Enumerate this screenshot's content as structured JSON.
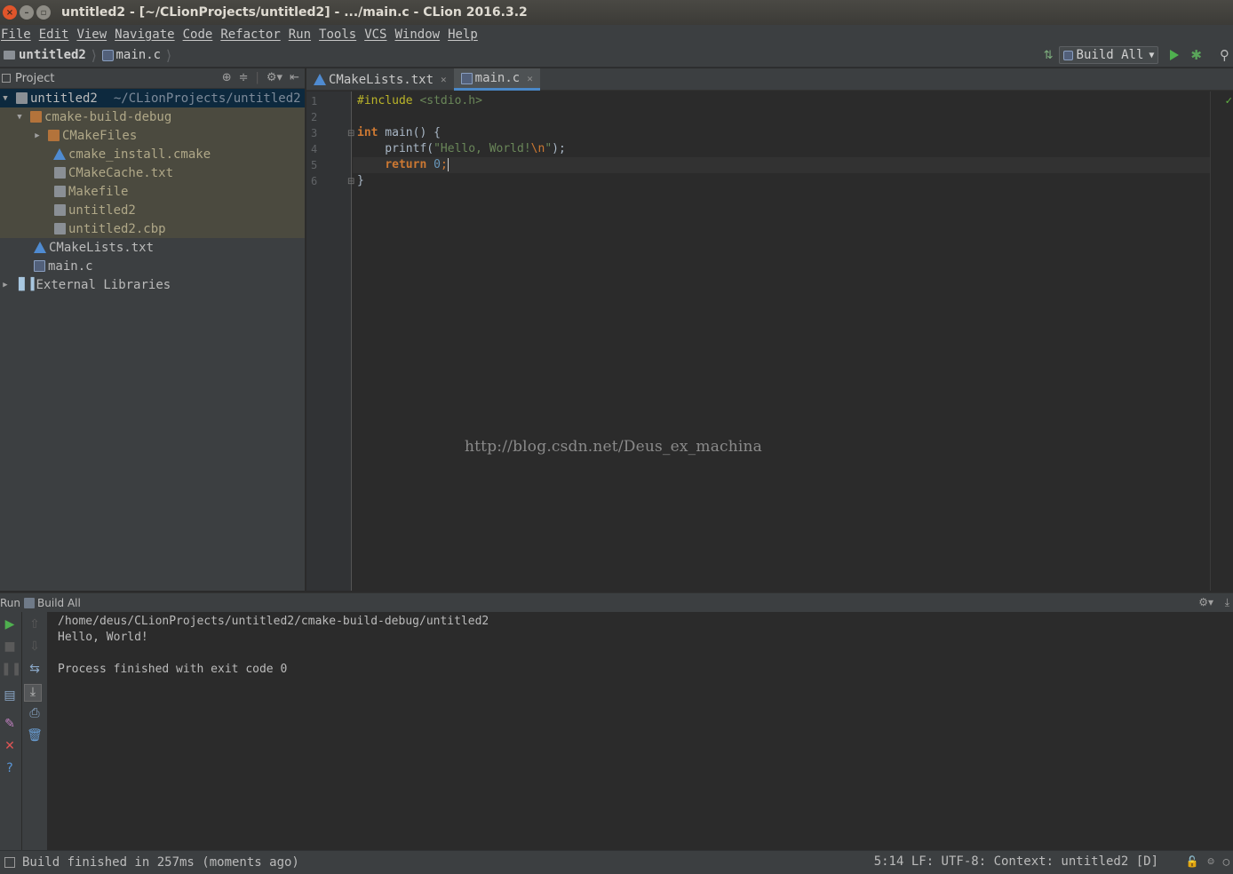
{
  "window": {
    "title": "untitled2 - [~/CLionProjects/untitled2] - .../main.c - CLion 2016.3.2",
    "close_glyph": "×",
    "min_glyph": "–",
    "max_glyph": "▫"
  },
  "menu": [
    "File",
    "Edit",
    "View",
    "Navigate",
    "Code",
    "Refactor",
    "Run",
    "Tools",
    "VCS",
    "Window",
    "Help"
  ],
  "navbar": {
    "project": "untitled2",
    "file": "main.c",
    "run_config": "Build All"
  },
  "project_panel": {
    "title": "Project",
    "tree": [
      {
        "label": "untitled2",
        "path": "~/CLionProjects/untitled2"
      },
      {
        "label": "cmake-build-debug"
      },
      {
        "label": "CMakeFiles"
      },
      {
        "label": "cmake_install.cmake"
      },
      {
        "label": "CMakeCache.txt"
      },
      {
        "label": "Makefile"
      },
      {
        "label": "untitled2"
      },
      {
        "label": "untitled2.cbp"
      },
      {
        "label": "CMakeLists.txt"
      },
      {
        "label": "main.c"
      },
      {
        "label": "External Libraries"
      }
    ]
  },
  "editor": {
    "tabs": [
      {
        "label": "CMakeLists.txt"
      },
      {
        "label": "main.c"
      }
    ],
    "line_numbers": [
      "1",
      "2",
      "3",
      "4",
      "5",
      "6"
    ],
    "code": {
      "l1_pp": "#include",
      "l1_inc": " <stdio.h>",
      "l3_kw": "int",
      "l3_rest": " main() {",
      "l4_pre": "    printf(",
      "l4_str": "\"Hello, World!",
      "l4_esc": "\\n",
      "l4_str_end": "\"",
      "l4_post": ");",
      "l5_pre": "    ",
      "l5_kw": "return",
      "l5_sp": " ",
      "l5_num": "0",
      "l5_post": ";",
      "l6": "}"
    },
    "watermark": "http://blog.csdn.net/Deus_ex_machina"
  },
  "run_panel": {
    "label": "Run",
    "config": "Build All",
    "console": [
      "/home/deus/CLionProjects/untitled2/cmake-build-debug/untitled2",
      "Hello, World!",
      "",
      "Process finished with exit code 0"
    ]
  },
  "status": {
    "message": "Build finished in 257ms (moments ago)",
    "right": "5:14  LF: UTF-8: Context: untitled2 [D]"
  }
}
